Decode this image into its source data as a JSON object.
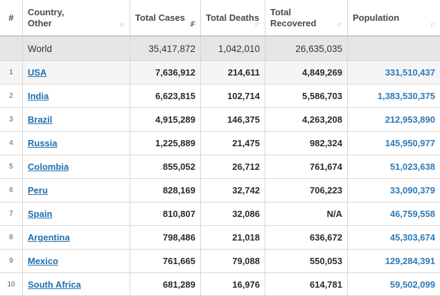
{
  "headers": {
    "rank": "#",
    "country": "Country, Other",
    "cases": "Total Cases",
    "deaths": "Total Deaths",
    "recovered": "Total Recovered",
    "population": "Population"
  },
  "world": {
    "name": "World",
    "cases": "35,417,872",
    "deaths": "1,042,010",
    "recovered": "26,635,035",
    "population": ""
  },
  "rows": [
    {
      "rank": "1",
      "country": "USA",
      "cases": "7,636,912",
      "deaths": "214,611",
      "recovered": "4,849,269",
      "population": "331,510,437"
    },
    {
      "rank": "2",
      "country": "India",
      "cases": "6,623,815",
      "deaths": "102,714",
      "recovered": "5,586,703",
      "population": "1,383,530,375"
    },
    {
      "rank": "3",
      "country": "Brazil",
      "cases": "4,915,289",
      "deaths": "146,375",
      "recovered": "4,263,208",
      "population": "212,953,890"
    },
    {
      "rank": "4",
      "country": "Russia",
      "cases": "1,225,889",
      "deaths": "21,475",
      "recovered": "982,324",
      "population": "145,950,977"
    },
    {
      "rank": "5",
      "country": "Colombia",
      "cases": "855,052",
      "deaths": "26,712",
      "recovered": "761,674",
      "population": "51,023,638"
    },
    {
      "rank": "6",
      "country": "Peru",
      "cases": "828,169",
      "deaths": "32,742",
      "recovered": "706,223",
      "population": "33,090,379"
    },
    {
      "rank": "7",
      "country": "Spain",
      "cases": "810,807",
      "deaths": "32,086",
      "recovered": "N/A",
      "population": "46,759,558"
    },
    {
      "rank": "8",
      "country": "Argentina",
      "cases": "798,486",
      "deaths": "21,018",
      "recovered": "636,672",
      "population": "45,303,674"
    },
    {
      "rank": "9",
      "country": "Mexico",
      "cases": "761,665",
      "deaths": "79,088",
      "recovered": "550,053",
      "population": "129,284,391"
    },
    {
      "rank": "10",
      "country": "South Africa",
      "cases": "681,289",
      "deaths": "16,976",
      "recovered": "614,781",
      "population": "59,502,099"
    }
  ],
  "colors": {
    "link": "#1f6fb0",
    "world_row_bg": "#e6e6e6",
    "border": "#d6d6d6"
  },
  "icons": {
    "sort": "sort-arrows-icon",
    "sort_active": "sort-descending-icon"
  }
}
